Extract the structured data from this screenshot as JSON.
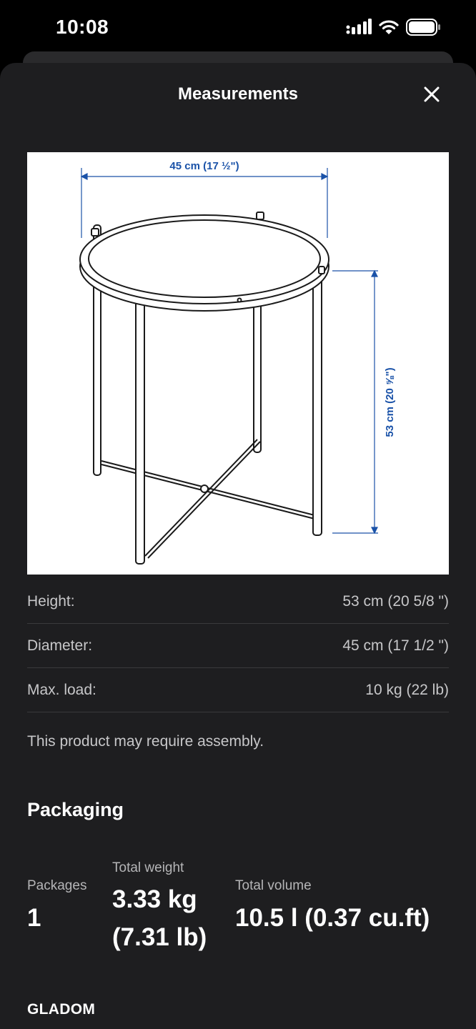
{
  "status_bar": {
    "time": "10:08"
  },
  "sheet": {
    "title": "Measurements"
  },
  "drawing": {
    "width_label": "45 cm (17 ½\")",
    "height_label": "53 cm (20 ⅝\")"
  },
  "measurements": [
    {
      "label": "Height:",
      "value": "53 cm (20 5/8 \")"
    },
    {
      "label": "Diameter:",
      "value": "45 cm (17 1/2 \")"
    },
    {
      "label": "Max. load:",
      "value": "10 kg (22 lb)"
    }
  ],
  "assembly_note": "This product may require assembly.",
  "packaging": {
    "heading": "Packaging",
    "packages_label": "Packages",
    "packages_value": "1",
    "weight_label": "Total weight",
    "weight_line1": "3.33 kg",
    "weight_line2": "(7.31 lb)",
    "volume_label": "Total volume",
    "volume_value": "10.5 l (0.37 cu.ft)"
  },
  "product_name": "GLADOM",
  "colors": {
    "sheet_bg": "#1e1e20",
    "dimension_blue": "#1a52a8",
    "divider": "#3a3a3c"
  },
  "icons": [
    "signal-icon",
    "wifi-icon",
    "battery-icon",
    "close-icon"
  ]
}
